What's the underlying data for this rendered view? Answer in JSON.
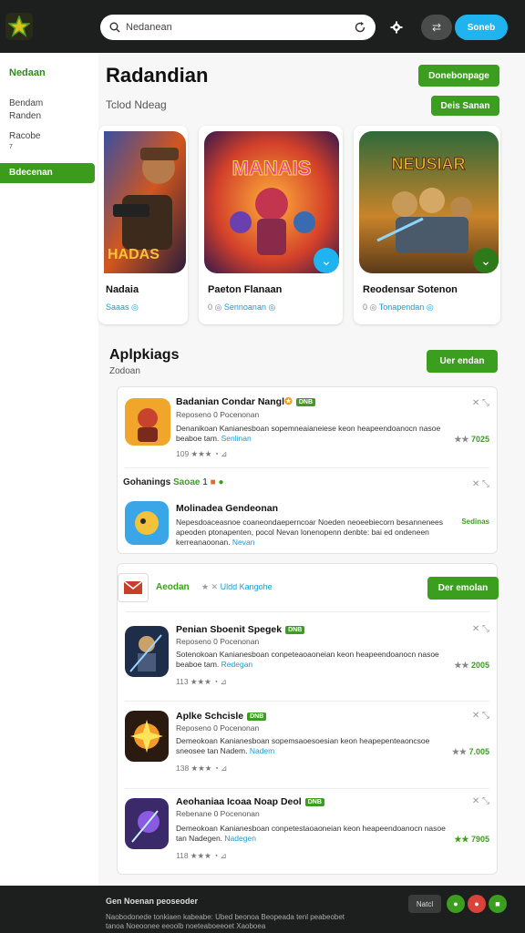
{
  "topbar": {
    "search_placeholder": "Nedanean",
    "search_value": "Nedanean",
    "dark_pill_label": "⇄",
    "blue_button_label": "Soneb"
  },
  "sidebar": {
    "heading": "Nedaan",
    "items": [
      {
        "label": "Bendam"
      },
      {
        "label": "Randen"
      },
      {
        "label": "Racobe"
      },
      {
        "label": "7"
      }
    ],
    "active_label": "Bdecenan"
  },
  "header": {
    "title": "Radandian",
    "subtitle": "Tclod Ndeag",
    "primary_button": "Donebonpage",
    "secondary_button": "Deis Sanan"
  },
  "featured": [
    {
      "name": "Nadaia",
      "meta": "Saaas"
    },
    {
      "name": "Paeton Flanaan",
      "meta": "Sennoanan",
      "rating_prefix": "0"
    },
    {
      "name": "Reodensar Sotenon",
      "meta": "Tonapendan",
      "rating_prefix": "0"
    }
  ],
  "section": {
    "title": "Aplpkiags",
    "subtitle": "Zodoan",
    "button": "Uer endan"
  },
  "apps_group1": [
    {
      "name": "Badanian Condar Nangl",
      "tag": "DNB",
      "line": "Reposeno 0 Pocenonan",
      "desc": "Denanikoan Kanianesboan sopemneaianeiese keon heapeendoanocn nasoe beaboe tam.",
      "link": "Senlinan",
      "stats": "109",
      "rating": "7025"
    },
    {
      "name": "Molinadea Gendeonan",
      "header_text": "Gohanings",
      "header_green": "Saoae",
      "header_num": "1",
      "desc": "Nepesdoaceasnoe coaneondaeperncoar Noeden neoeebiecorn besannenees apeoden ptonapenten, pocol Nevan lonenopenn denbte: bai ed ondeneen kerreanaoonan.",
      "link": "Nevan",
      "rating": "Sedinas"
    }
  ],
  "group2": {
    "label": "Aeodan",
    "link": "Uldd Kangohe",
    "button": "Der emolan"
  },
  "apps_group2": [
    {
      "name": "Penian Sboenit Spegek",
      "tag": "DNB",
      "line": "Reposeno 0 Pocenonan",
      "desc": "Sotenokoan Kanianesboan conpeteaoaoneian keon heapeendoanocn nasoe beaboe tam.",
      "link": "Redegan",
      "stats": "113",
      "rating": "2005"
    },
    {
      "name": "Aplke Schcisle",
      "tag": "DNB",
      "line": "Reposeno 0 Pocenonan",
      "desc": "Demeokoan Kanianesboan sopemsaoesoesian keon heapepenteaoncsoe sneosee tan Nadem.",
      "link": "Nadem",
      "stats": "138",
      "rating": "7.005"
    },
    {
      "name": "Aeohaniaa Icoaa Noap Deol",
      "tag": "DNB",
      "line": "Rebenane 0 Pocenonan",
      "desc": "Demeokoan Kanianesboan conpetestaoaoneian keon heapeendoanocn nasoe tan Nadegen.",
      "link": "Nadegen",
      "stats": "118",
      "rating": "7905"
    }
  ],
  "footer": {
    "title": "Gen Noenan peoseoder",
    "text": "Naobodonede tonkiaen kabeabe: Ubed beonoa Beopeada tenl peabeobet tanoa Noeoonee eeoolb noeteaboeeoet Xaoboea",
    "pill": "Natcl"
  },
  "colors": {
    "accent_green": "#3c9e1e",
    "accent_blue": "#1fb4ef",
    "topbar": "#1d1f1e"
  }
}
